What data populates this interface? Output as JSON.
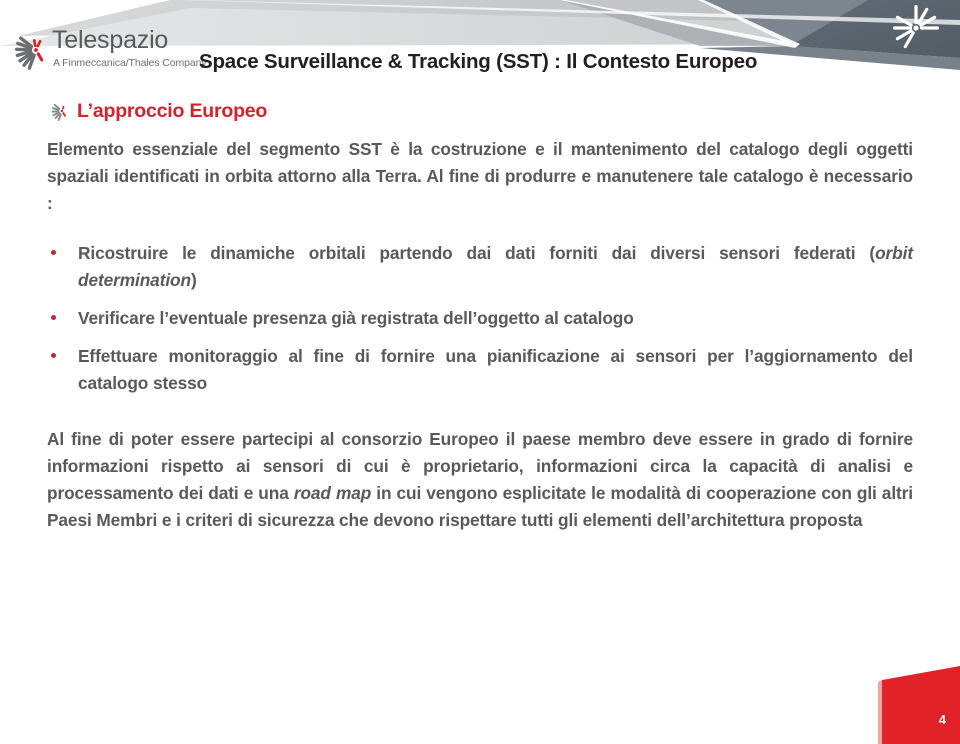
{
  "brand": {
    "name": "Telespazio",
    "tagline": "A Finmeccanica/Thales Company",
    "logo_icon": "fan-starburst-icon",
    "accent_color": "#d7202a",
    "gray_color": "#58595b"
  },
  "header": {
    "title": "Space Surveillance & Tracking (SST) : Il Contesto Europeo",
    "title_color": "#231f20",
    "banner_icon": "fan-starburst-icon",
    "banner_color": "#5b6670"
  },
  "section": {
    "icon": "fan-starburst-icon",
    "heading": "L’approccio Europeo",
    "heading_color": "#d7202a"
  },
  "body": {
    "lead_paragraph": "Elemento essenziale del segmento SST è la costruzione e il mantenimento del catalogo degli oggetti spaziali identificati in orbita attorno alla Terra. Al fine di produrre e manutenere tale catalogo è necessario :",
    "bullets": [
      {
        "text_before": "Ricostruire le dinamiche orbitali partendo dai dati forniti dai diversi sensori federati (",
        "italic": "orbit determination",
        "text_after": ")"
      },
      {
        "text_before": "Verificare l’eventuale presenza già registrata dell’oggetto al catalogo",
        "italic": "",
        "text_after": ""
      },
      {
        "text_before": "Effettuare monitoraggio al fine di fornire una pianificazione ai sensori per l’aggiornamento del catalogo stesso",
        "italic": "",
        "text_after": ""
      }
    ],
    "bullet_marker_color": "#c0272d",
    "closing_before": "Al fine di poter essere partecipi al consorzio Europeo il paese membro deve essere in grado di fornire informazioni rispetto ai sensori di cui è proprietario, informazioni circa la capacità di analisi e processamento dei dati e una ",
    "closing_italic": "road map",
    "closing_after": " in cui vengono esplicitate le modalità di cooperazione con gli altri Paesi Membri e i criteri di sicurezza che devono rispettare tutti gli elementi dell’architettura proposta"
  },
  "footer": {
    "page_number": "4",
    "marker_color": "#e12228"
  }
}
